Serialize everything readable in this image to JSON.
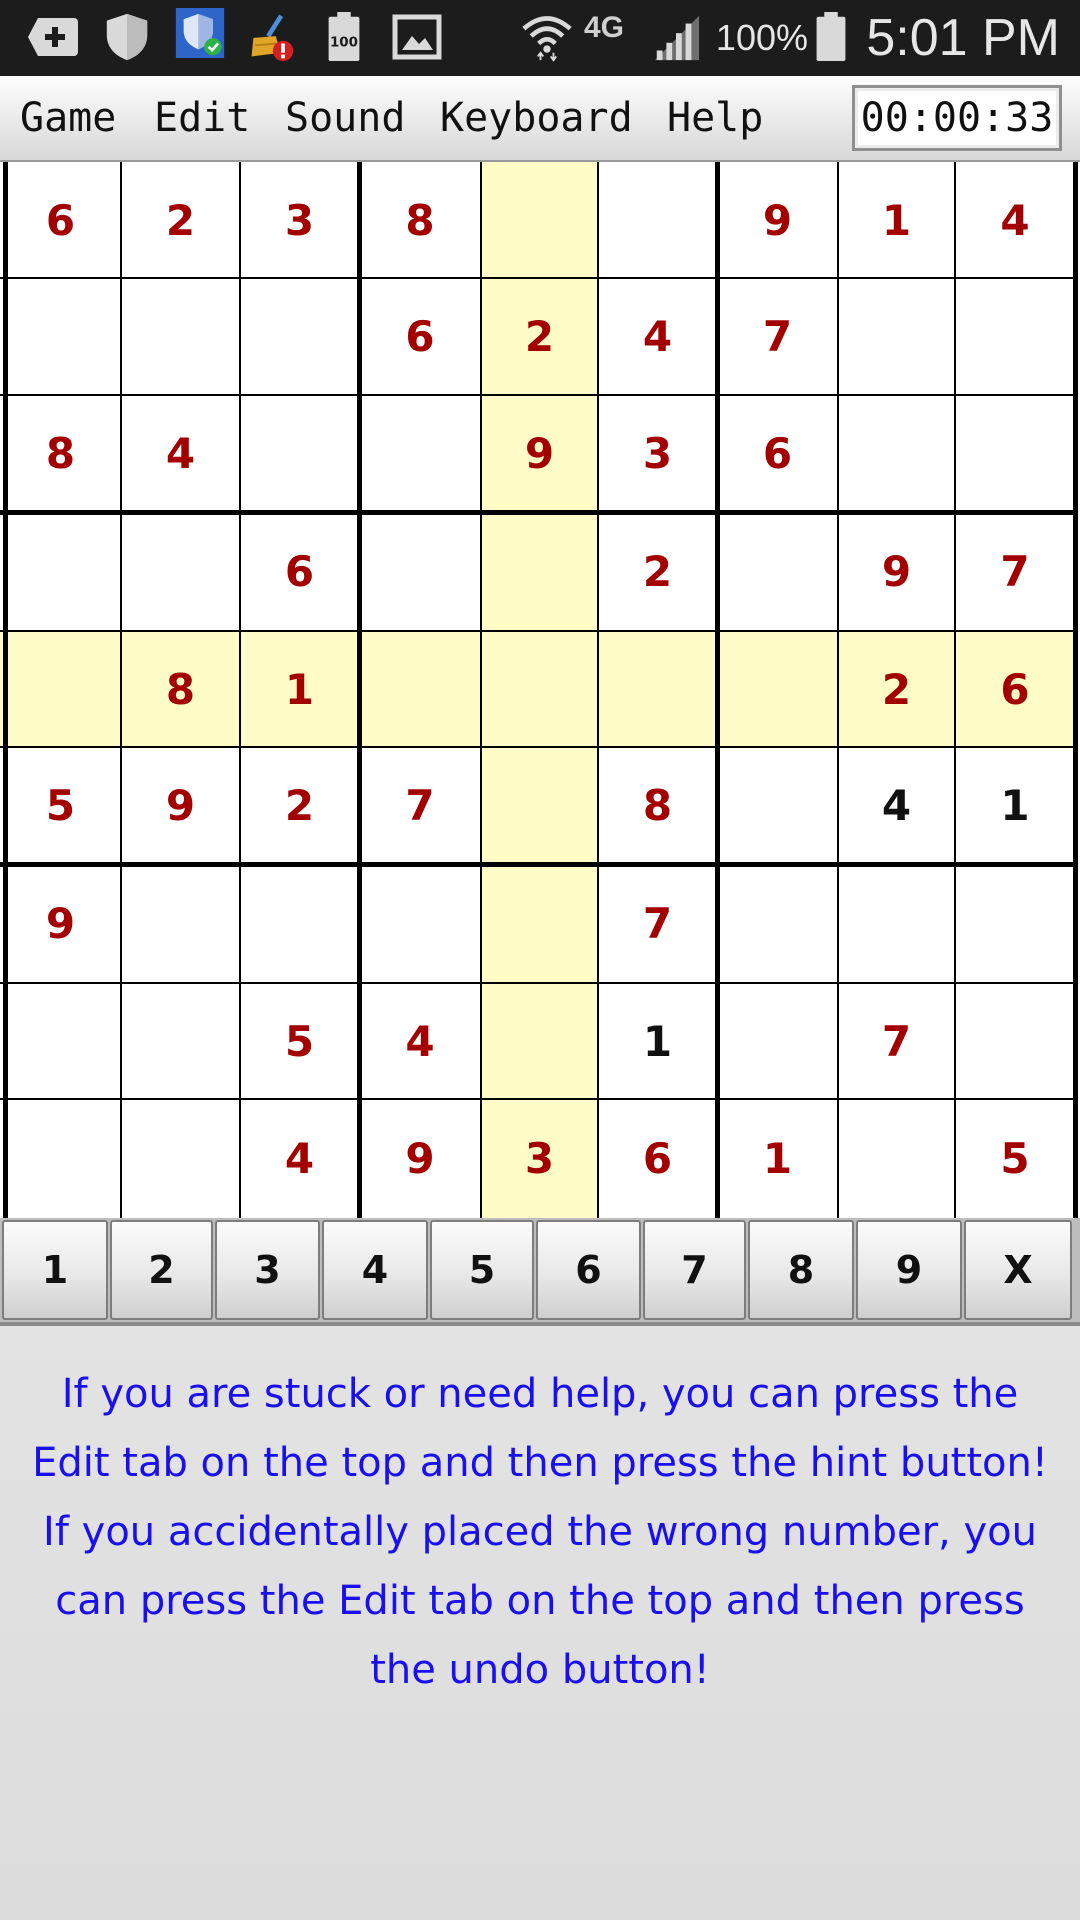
{
  "status_bar": {
    "icons": [
      "add-box-icon",
      "shield-icon",
      "security-shield-check-icon",
      "cleaner-broom-alert-icon",
      "battery-saver-100-icon",
      "gallery-icon",
      "wifi-icon",
      "lte-signal-icon",
      "battery-icon"
    ],
    "badge_100": "100",
    "network": "4G",
    "battery_percent": "100%",
    "time": "5:01 PM"
  },
  "menu": {
    "items": [
      "Game",
      "Edit",
      "Sound",
      "Keyboard",
      "Help"
    ],
    "timer": "00:00:33"
  },
  "board": {
    "rows": [
      [
        "6",
        "2",
        "3",
        "8",
        "",
        "",
        "9",
        "1",
        "4"
      ],
      [
        "",
        "",
        "",
        "6",
        "2",
        "4",
        "7",
        "",
        ""
      ],
      [
        "8",
        "4",
        "",
        "",
        "9",
        "3",
        "6",
        "",
        ""
      ],
      [
        "",
        "",
        "6",
        "",
        "",
        "2",
        "",
        "9",
        "7"
      ],
      [
        "",
        "8",
        "1",
        "",
        "",
        "",
        "",
        "2",
        "6"
      ],
      [
        "5",
        "9",
        "2",
        "7",
        "",
        "8",
        "",
        "4",
        "1"
      ],
      [
        "9",
        "",
        "",
        "",
        "",
        "7",
        "",
        "",
        ""
      ],
      [
        "",
        "",
        "5",
        "4",
        "",
        "1",
        "",
        "7",
        ""
      ],
      [
        "",
        "",
        "4",
        "9",
        "3",
        "6",
        "1",
        "",
        "5"
      ]
    ],
    "user_entered_cells": [
      [
        5,
        7
      ],
      [
        5,
        8
      ],
      [
        7,
        5
      ]
    ],
    "highlighted_row": 4,
    "highlighted_col": 4,
    "colors": {
      "given": "#a30000",
      "user_entered": "#111111",
      "highlight": "#fffcc8"
    }
  },
  "keypad": {
    "keys": [
      "1",
      "2",
      "3",
      "4",
      "5",
      "6",
      "7",
      "8",
      "9",
      "X"
    ]
  },
  "help": {
    "lines": [
      "If you are stuck or need help, you can press the",
      "Edit tab on the top and then press the hint button!",
      "If you accidentally placed the wrong number, you",
      "can press the Edit tab on the top and then press",
      "the undo button!"
    ],
    "color": "#1a0ff0"
  }
}
